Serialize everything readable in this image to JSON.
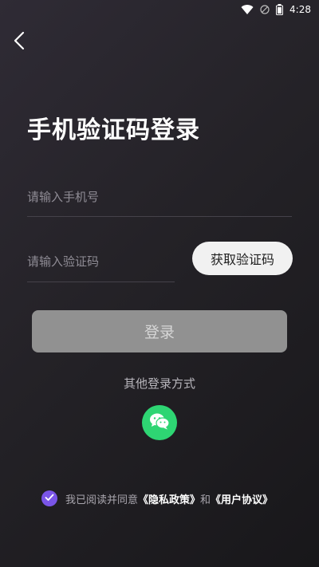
{
  "status_bar": {
    "time": "4:28",
    "icons": [
      "wifi-icon",
      "no-signal-icon",
      "battery-icon"
    ]
  },
  "header": {
    "back_icon": "chevron-left-icon",
    "title": "手机验证码登录"
  },
  "form": {
    "phone_placeholder": "请输入手机号",
    "code_placeholder": "请输入验证码",
    "get_code_label": "获取验证码",
    "login_label": "登录"
  },
  "other_login": {
    "label": "其他登录方式",
    "wechat_icon": "wechat-icon"
  },
  "agreement": {
    "checked": true,
    "prefix": "我已阅读并同意",
    "privacy_link": "《隐私政策》",
    "conjunction": "和",
    "user_agreement_link": "《用户协议》"
  },
  "colors": {
    "background": "#242227",
    "accent_purple": "#7a55e8",
    "wechat_green": "#2ed573",
    "login_button": "#919191"
  }
}
